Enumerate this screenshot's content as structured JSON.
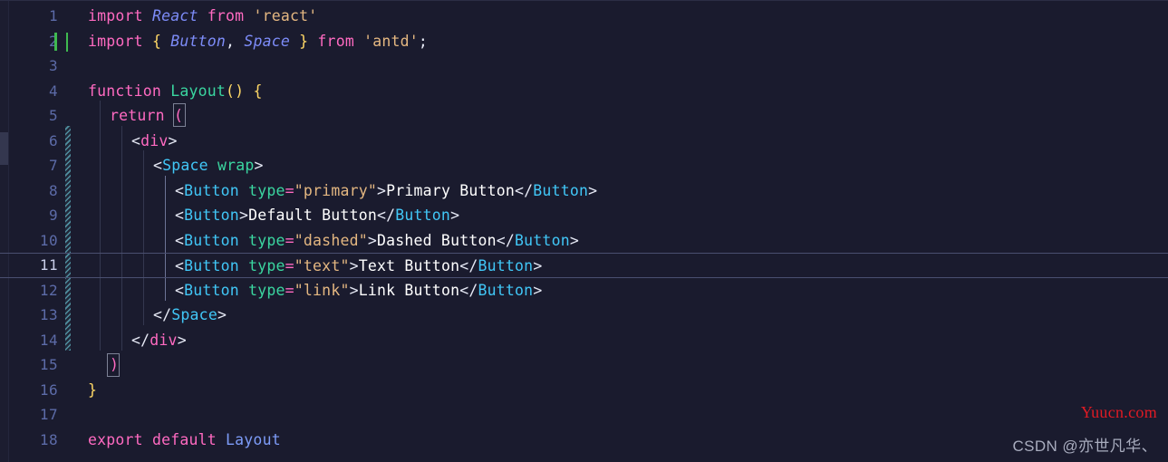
{
  "editor": {
    "background": "#1a1b2e",
    "active_line_number": 11,
    "caret_line": 2,
    "total_lines": 18,
    "line_numbers": [
      "1",
      "2",
      "3",
      "4",
      "5",
      "6",
      "7",
      "8",
      "9",
      "10",
      "11",
      "12",
      "13",
      "14",
      "15",
      "16",
      "17",
      "18"
    ],
    "lines": [
      {
        "n": "1",
        "text": "import React from 'react'"
      },
      {
        "n": "2",
        "text": "import { Button, Space } from 'antd';"
      },
      {
        "n": "3",
        "text": ""
      },
      {
        "n": "4",
        "text": "function Layout() {"
      },
      {
        "n": "5",
        "text": "  return ("
      },
      {
        "n": "6",
        "text": "    <div>"
      },
      {
        "n": "7",
        "text": "      <Space wrap>"
      },
      {
        "n": "8",
        "text": "        <Button type=\"primary\">Primary Button</Button>"
      },
      {
        "n": "9",
        "text": "        <Button>Default Button</Button>"
      },
      {
        "n": "10",
        "text": "        <Button type=\"dashed\">Dashed Button</Button>"
      },
      {
        "n": "11",
        "text": "        <Button type=\"text\">Text Button</Button>"
      },
      {
        "n": "12",
        "text": "        <Button type=\"link\">Link Button</Button>"
      },
      {
        "n": "13",
        "text": "      </Space>"
      },
      {
        "n": "14",
        "text": "    </div>"
      },
      {
        "n": "15",
        "text": "  )"
      },
      {
        "n": "16",
        "text": "}"
      },
      {
        "n": "17",
        "text": ""
      },
      {
        "n": "18",
        "text": "export default Layout"
      }
    ],
    "tokens": {
      "kw_import": "import",
      "kw_from": "from",
      "kw_function": "function",
      "kw_return": "return",
      "kw_export": "export",
      "kw_default": "default",
      "ident_react": "React",
      "ident_button": "Button",
      "ident_space": "Space",
      "ident_layout": "Layout",
      "str_react": "'react'",
      "str_antd": "'antd'",
      "str_primary": "\"primary\"",
      "str_dashed": "\"dashed\"",
      "str_text": "\"text\"",
      "str_link": "\"link\"",
      "attr_type": "type",
      "attr_wrap": "wrap",
      "tag_div": "div",
      "tag_space": "Space",
      "tag_button": "Button",
      "label_primary": "Primary Button",
      "label_default": "Default Button",
      "label_dashed": "Dashed Button",
      "label_text": "Text Button",
      "label_link": "Link Button",
      "brace_open": "{",
      "brace_close": "}",
      "paren_open": "(",
      "paren_close": ")",
      "comma": ",",
      "semicolon": ";",
      "lt": "<",
      "gt": ">",
      "lt_slash": "</",
      "eq": "=",
      "space": " "
    },
    "colors": {
      "background": "#1a1b2e",
      "keyword": "#ff6ac1",
      "string": "#e4b781",
      "brace": "#ffd866",
      "component_tag": "#41c7f7",
      "html_tag": "#ff6ac1",
      "attribute": "#3ad6a0",
      "function_name": "#3ad6a0",
      "import_identifier": "#7d8cf8",
      "jsx_text": "#ffffff",
      "line_number": "#5c6ba8",
      "line_number_active": "#c8cde8",
      "git_modified": "#3fb950",
      "hatch_decoration": "#4f8fa0",
      "active_line_border": "#4a4f70"
    },
    "decorations": {
      "git_modified_line": 2,
      "hatched_gutter_range": [
        6,
        14
      ],
      "bracket_match_lines": [
        5,
        15
      ]
    }
  },
  "watermarks": {
    "yuucn": "Yuucn.com",
    "csdn": "CSDN @亦世凡华、"
  }
}
